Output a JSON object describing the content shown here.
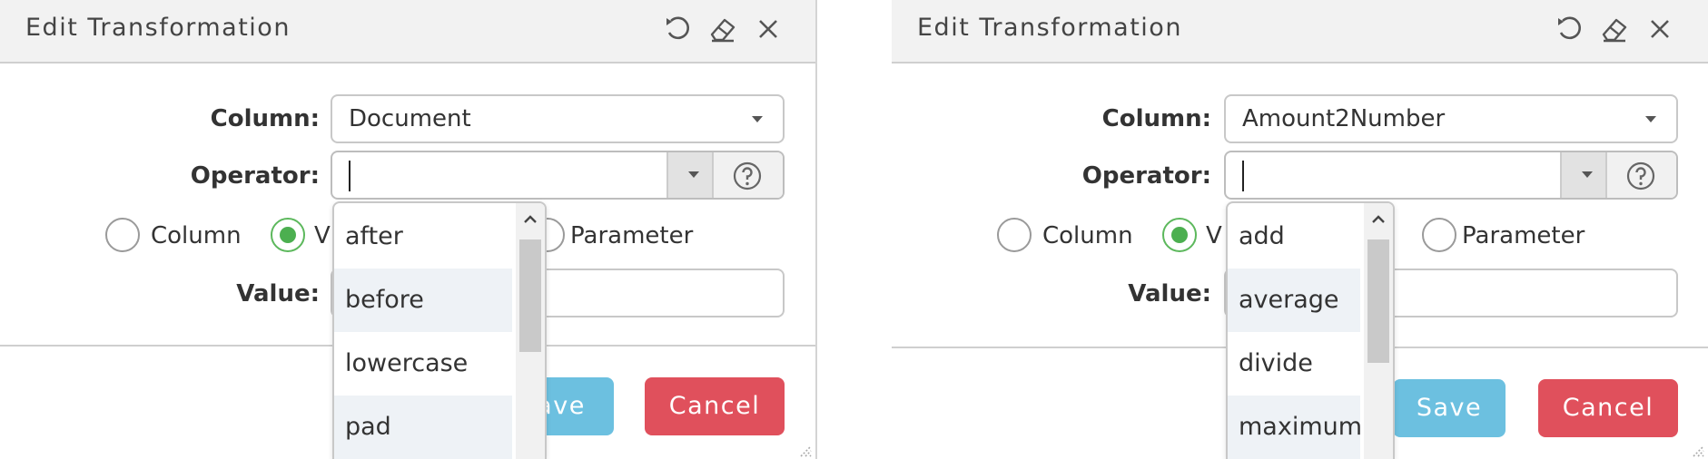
{
  "dialogs": [
    {
      "title": "Edit Transformation",
      "column_label": "Column:",
      "column_value": "Document",
      "operator_label": "Operator:",
      "operator_value": "",
      "radios": [
        {
          "label": "Column",
          "checked": false
        },
        {
          "label": "V",
          "checked": true
        },
        {
          "label": "Parameter",
          "checked": false
        }
      ],
      "value_label": "Value:",
      "value_input": "",
      "save_label": "ave",
      "cancel_label": "Cancel",
      "dropdown_items": [
        "after",
        "before",
        "lowercase",
        "pad"
      ]
    },
    {
      "title": "Edit Transformation",
      "column_label": "Column:",
      "column_value": "Amount2Number",
      "operator_label": "Operator:",
      "operator_value": "",
      "radios": [
        {
          "label": "Column",
          "checked": false
        },
        {
          "label": "V",
          "checked": true
        },
        {
          "label": "Parameter",
          "checked": false
        }
      ],
      "value_label": "Value:",
      "value_input": "",
      "save_label": "Save",
      "cancel_label": "Cancel",
      "dropdown_items": [
        "add",
        "average",
        "divide",
        "maximum"
      ]
    }
  ],
  "icons": {
    "undo": "undo-icon",
    "eraser": "eraser-icon",
    "close": "close-icon",
    "help": "help-circle-icon"
  },
  "colors": {
    "save_button": "#6cc0e0",
    "cancel_button": "#e0505c",
    "radio_checked": "#4caf50",
    "header_bg": "#f2f2f2",
    "dropdown_alt_row": "#eef2f6"
  }
}
